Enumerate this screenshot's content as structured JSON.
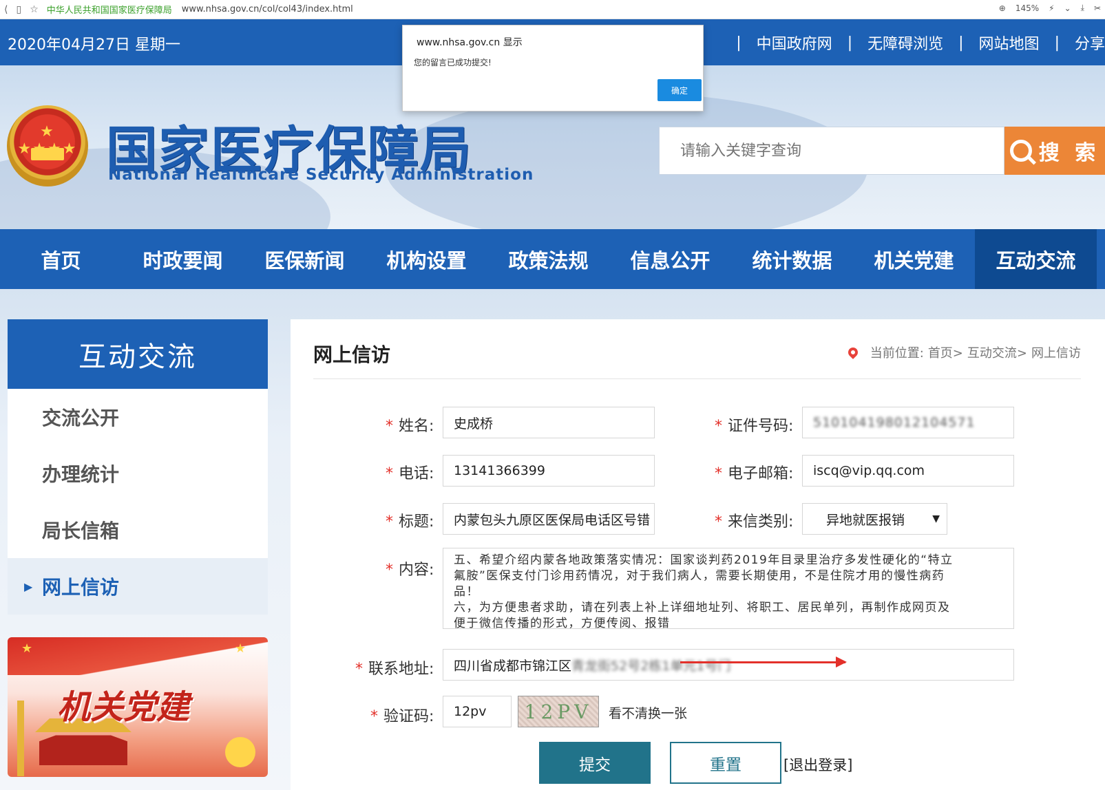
{
  "browser": {
    "page_title": "中华人民共和国国家医疗保障局",
    "url": "www.nhsa.gov.cn/col/col43/index.html",
    "zoom": "145%"
  },
  "topbar": {
    "date": "2020年04月27日 星期一",
    "links": [
      "中国政府网",
      "无障碍浏览",
      "网站地图",
      "分享"
    ]
  },
  "header": {
    "title": "国家医疗保障局",
    "subtitle": "National Healthcare Security Administration",
    "search_placeholder": "请输入关键字查询",
    "search_button": "搜 索"
  },
  "nav": {
    "items": [
      "首页",
      "时政要闻",
      "医保新闻",
      "机构设置",
      "政策法规",
      "信息公开",
      "统计数据",
      "机关党建",
      "互动交流"
    ],
    "active_index": 8
  },
  "sidebar": {
    "title": "互动交流",
    "items": [
      "交流公开",
      "办理统计",
      "局长信箱",
      "网上信访"
    ],
    "active_index": 3,
    "banner_text": "机关党建"
  },
  "main": {
    "title": "网上信访",
    "breadcrumb": {
      "label": "当前位置:",
      "home": "首页>",
      "level2": "互动交流>",
      "level3": "网上信访"
    }
  },
  "form": {
    "name": {
      "label": "姓名:",
      "value": "史成桥"
    },
    "id_number": {
      "label": "证件号码:",
      "value": "510104198012104571"
    },
    "phone": {
      "label": "电话:",
      "value": "13141366399"
    },
    "email": {
      "label": "电子邮箱:",
      "value": "iscq@vip.qq.com"
    },
    "subject": {
      "label": "标题:",
      "value": "内蒙包头九原区医保局电话区号错"
    },
    "category": {
      "label": "来信类别:",
      "value": "异地就医报销"
    },
    "content": {
      "label": "内容:",
      "line1": "五、希望介绍内蒙各地政策落实情况：国家谈判药2019年目录里治疗多发性硬化的“特立",
      "line2": "氟胺”医保支付门诊用药情况，对于我们病人，需要长期使用，不是住院才用的慢性病药",
      "line3": "品！",
      "line4": "六，为方便患者求助，请在列表上补上详细地址列、将职工、居民单列，再制作成网页及",
      "line5": "便于微信传播的形式，方便传阅、报错"
    },
    "address": {
      "label": "联系地址:",
      "value": "四川省成都市锦江区",
      "value_obscured": "青龙街52号2栋1单元1号门"
    },
    "captcha": {
      "label": "验证码:",
      "value": "12pv",
      "image_text": "12PV",
      "refresh_link": "看不清换一张"
    },
    "submit_label": "提交",
    "reset_label": "重置",
    "logout_label": "[退出登录]",
    "required_mark": "*"
  },
  "dialog": {
    "title": "www.nhsa.gov.cn 显示",
    "message": "您的留言已成功提交!",
    "ok_label": "确定"
  },
  "colors": {
    "brand_blue": "#1d61b5",
    "nav_active": "#0e4a91",
    "search_orange": "#ec8637",
    "submit_teal": "#21738a",
    "required_red": "#e3302a",
    "dialog_button": "#1a8be0"
  }
}
